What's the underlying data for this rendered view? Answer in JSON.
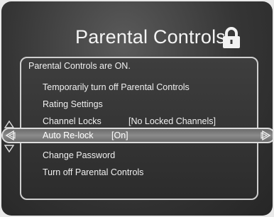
{
  "screen": {
    "title": "Parental Controls",
    "status": "Parental Controls are ON."
  },
  "menu": {
    "items": [
      {
        "label": "Temporarily turn off Parental Controls",
        "value": ""
      },
      {
        "label": "Rating Settings",
        "value": ""
      },
      {
        "label": "Channel Locks",
        "value": "[No Locked Channels]"
      },
      {
        "label": "Auto Re-lock",
        "value": "[On]"
      },
      {
        "label": "Change Password",
        "value": ""
      },
      {
        "label": "Turn off Parental Controls",
        "value": ""
      }
    ],
    "selected_index": 3
  },
  "icons": {
    "title_icon": "lock-icon",
    "nav": [
      "up-arrow-icon",
      "down-arrow-icon",
      "left-arrow-icon",
      "right-arrow-icon"
    ]
  }
}
